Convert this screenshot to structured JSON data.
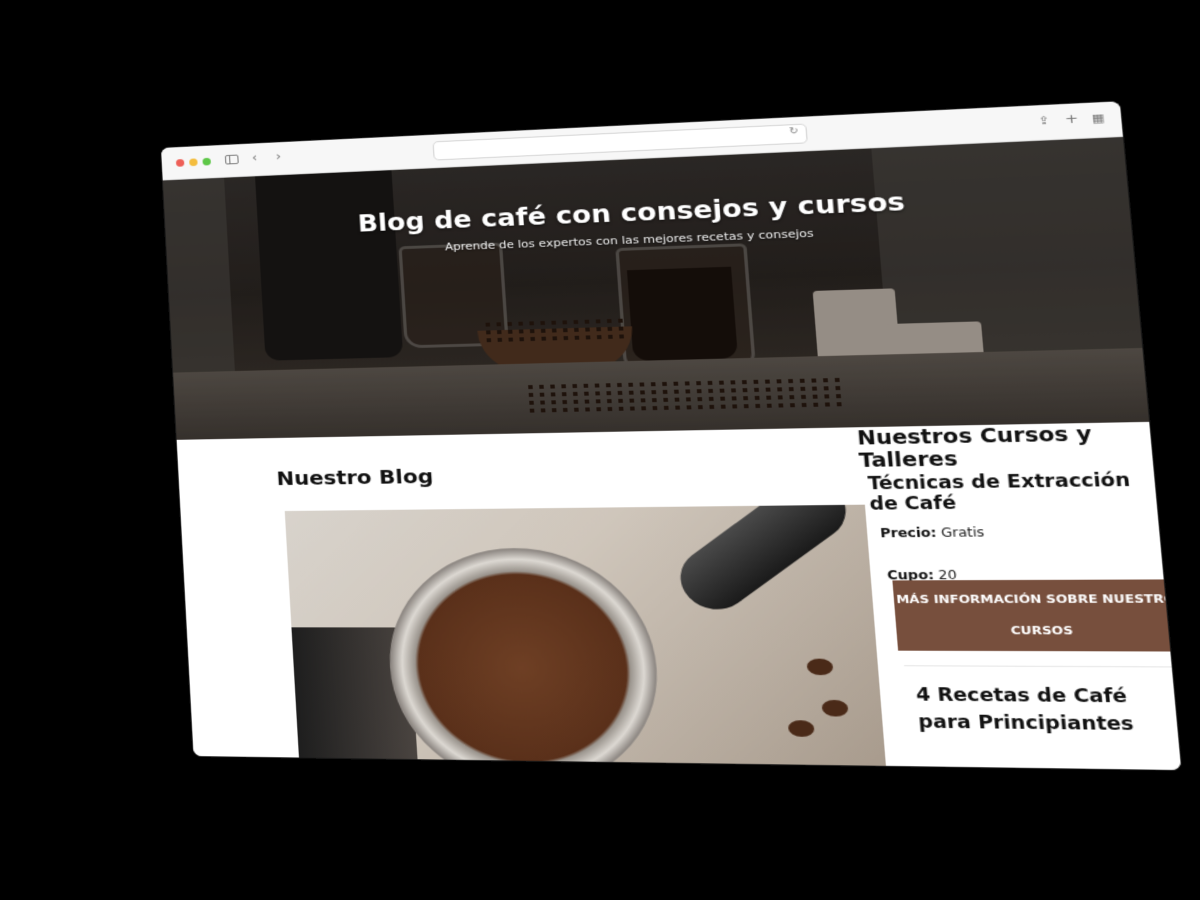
{
  "browser": {
    "url": "",
    "controls": {
      "back_icon": "chevron-left-icon",
      "forward_icon": "chevron-right-icon",
      "share_icon": "share-icon",
      "new_tab_icon": "plus-icon",
      "tabs_icon": "tab-overview-icon"
    }
  },
  "hero": {
    "title": "Blog de café con consejos y cursos",
    "subtitle": "Aprende de los expertos con las mejores recetas y consejos"
  },
  "blog": {
    "heading": "Nuestro Blog"
  },
  "courses": {
    "heading": "Nuestros Cursos y Talleres",
    "items": [
      {
        "title": "Técnicas de Extracción de Café",
        "price_label": "Precio:",
        "price_value": "Gratis",
        "quota_label": "Cupo:",
        "quota_value": "20",
        "button_label": "Más información sobre nuestros cursos"
      },
      {
        "title": "4 Recetas de Café para Principiantes"
      }
    ]
  },
  "colors": {
    "button_bg": "#774f3d",
    "page_bg": "#000000"
  }
}
